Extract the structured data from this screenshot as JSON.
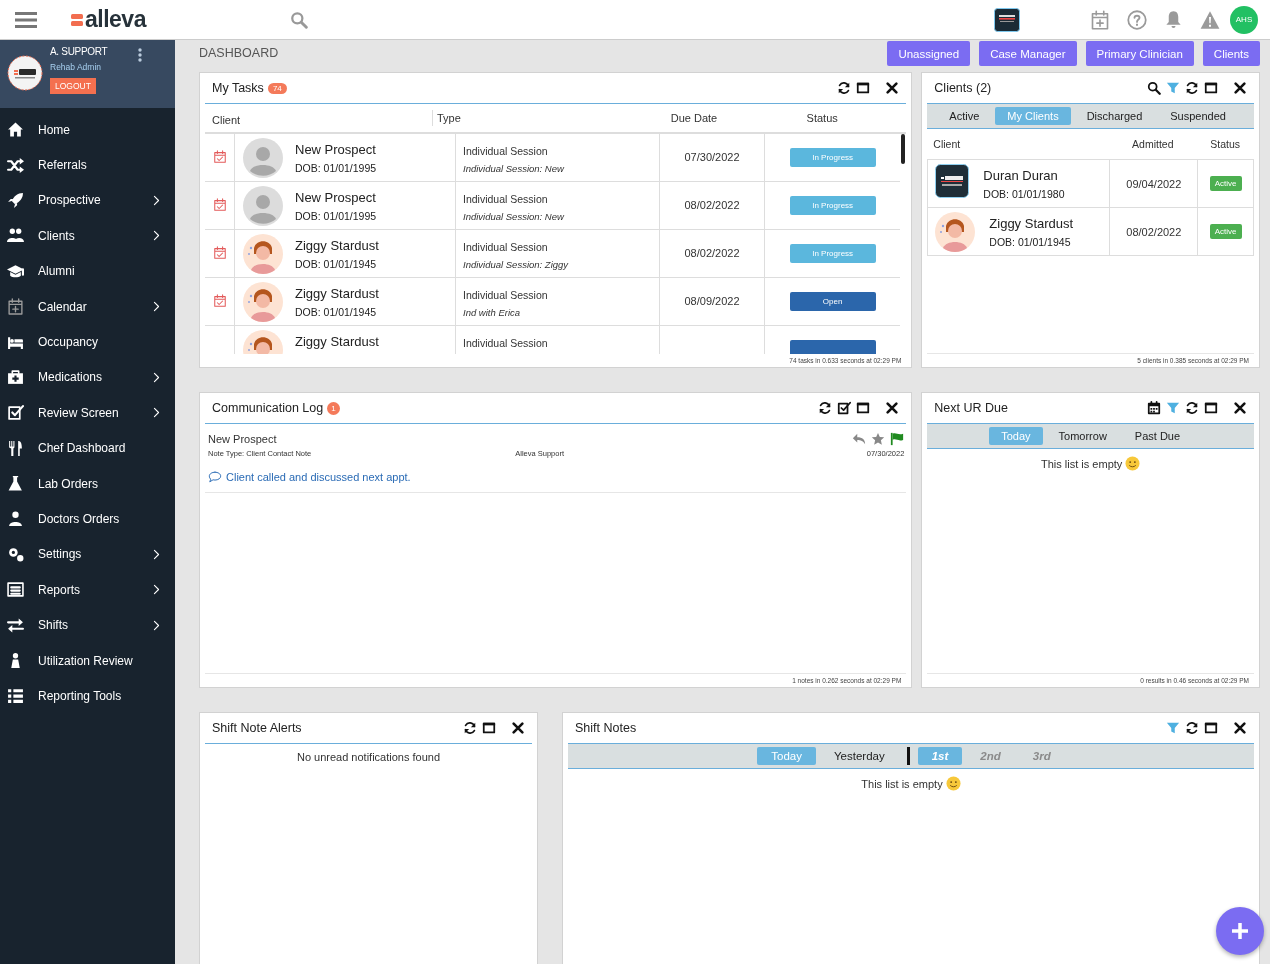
{
  "topbar": {
    "logo": "alleva",
    "user_initials": "AHS"
  },
  "profile": {
    "name": "A. SUPPORT",
    "role": "Rehab Admin",
    "logout": "LOGOUT"
  },
  "nav": [
    {
      "label": "Home",
      "has_submenu": false
    },
    {
      "label": "Referrals",
      "has_submenu": false
    },
    {
      "label": "Prospective",
      "has_submenu": true
    },
    {
      "label": "Clients",
      "has_submenu": true
    },
    {
      "label": "Alumni",
      "has_submenu": false
    },
    {
      "label": "Calendar",
      "has_submenu": true
    },
    {
      "label": "Occupancy",
      "has_submenu": false
    },
    {
      "label": "Medications",
      "has_submenu": true
    },
    {
      "label": "Review Screen",
      "has_submenu": true
    },
    {
      "label": "Chef Dashboard",
      "has_submenu": false
    },
    {
      "label": "Lab Orders",
      "has_submenu": false
    },
    {
      "label": "Doctors Orders",
      "has_submenu": false
    },
    {
      "label": "Settings",
      "has_submenu": true
    },
    {
      "label": "Reports",
      "has_submenu": true
    },
    {
      "label": "Shifts",
      "has_submenu": true
    },
    {
      "label": "Utilization Review",
      "has_submenu": false
    },
    {
      "label": "Reporting Tools",
      "has_submenu": false
    }
  ],
  "page_title": "DASHBOARD",
  "filter_buttons": [
    "Unassigned",
    "Case Manager",
    "Primary Clinician",
    "Clients"
  ],
  "tasks": {
    "title": "My Tasks",
    "count": "74",
    "columns": [
      "Client",
      "Type",
      "Due Date",
      "Status"
    ],
    "rows": [
      {
        "kind": "placeholder",
        "name": "New Prospect",
        "dob": "DOB: 01/01/1995",
        "type": "Individual Session",
        "subtype": "Individual Session: New",
        "due": "07/30/2022",
        "status": {
          "kind": "in_progress",
          "label": "In Progress"
        }
      },
      {
        "kind": "placeholder",
        "name": "New Prospect",
        "dob": "DOB: 01/01/1995",
        "type": "Individual Session",
        "subtype": "Individual Session: New",
        "due": "08/02/2022",
        "status": {
          "kind": "in_progress",
          "label": "In Progress"
        }
      },
      {
        "kind": "photo",
        "name": "Ziggy Stardust",
        "dob": "DOB: 01/01/1945",
        "type": "Individual Session",
        "subtype": "Individual Session: Ziggy",
        "due": "08/02/2022",
        "status": {
          "kind": "in_progress",
          "label": "In Progress"
        }
      },
      {
        "kind": "photo",
        "name": "Ziggy Stardust",
        "dob": "DOB: 01/01/1945",
        "type": "Individual Session",
        "subtype": "Ind with Erica",
        "due": "08/09/2022",
        "status": {
          "kind": "open",
          "label": "Open"
        }
      },
      {
        "kind": "photo",
        "name": "Ziggy Stardust",
        "type": "Individual Session",
        "status": {
          "kind": "open"
        }
      }
    ],
    "footer": "74 tasks in 0.633 seconds at 02:29 PM"
  },
  "clients": {
    "title": "Clients (2)",
    "tabs": [
      {
        "label": "Active",
        "selected": false
      },
      {
        "label": "My Clients",
        "selected": true
      },
      {
        "label": "Discharged",
        "selected": false
      },
      {
        "label": "Suspended",
        "selected": false
      }
    ],
    "columns": [
      "Client",
      "Admitted",
      "Status"
    ],
    "rows": [
      {
        "kind": "logo",
        "name": "Duran Duran",
        "dob": "DOB: 01/01/1980",
        "admitted": "09/04/2022",
        "status": "Active"
      },
      {
        "kind": "photo",
        "name": "Ziggy Stardust",
        "dob": "DOB: 01/01/1945",
        "admitted": "08/02/2022",
        "status": "Active"
      }
    ],
    "footer": "5 clients in 0.385 seconds at 02:29 PM"
  },
  "communication_log": {
    "title": "Communication Log",
    "count": "1",
    "notes": [
      {
        "client": "New Prospect",
        "note_type": "Note Type: Client Contact Note",
        "author": "Alleva Support",
        "date": "07/30/2022",
        "text": "Client called and discussed next appt.",
        "flagged": true
      }
    ],
    "footer": "1 notes in 0.262 seconds at 02:29 PM"
  },
  "next_ur_due": {
    "title": "Next UR Due",
    "tabs": [
      {
        "label": "Today",
        "selected": true
      },
      {
        "label": "Tomorrow",
        "selected": false
      },
      {
        "label": "Past Due",
        "selected": false
      }
    ],
    "empty": "This list is empty",
    "footer": "0 results in 0.46 seconds at 02:29 PM"
  },
  "shift_note_alerts": {
    "title": "Shift Note Alerts",
    "empty": "No unread notifications found"
  },
  "shift_notes": {
    "title": "Shift Notes",
    "day_tabs": [
      {
        "label": "Today",
        "selected": true
      },
      {
        "label": "Yesterday",
        "selected": false
      }
    ],
    "shift_tabs": [
      {
        "label": "1st",
        "selected": true
      },
      {
        "label": "2nd",
        "selected": false
      },
      {
        "label": "3rd",
        "selected": false
      }
    ],
    "empty": "This list is empty"
  }
}
